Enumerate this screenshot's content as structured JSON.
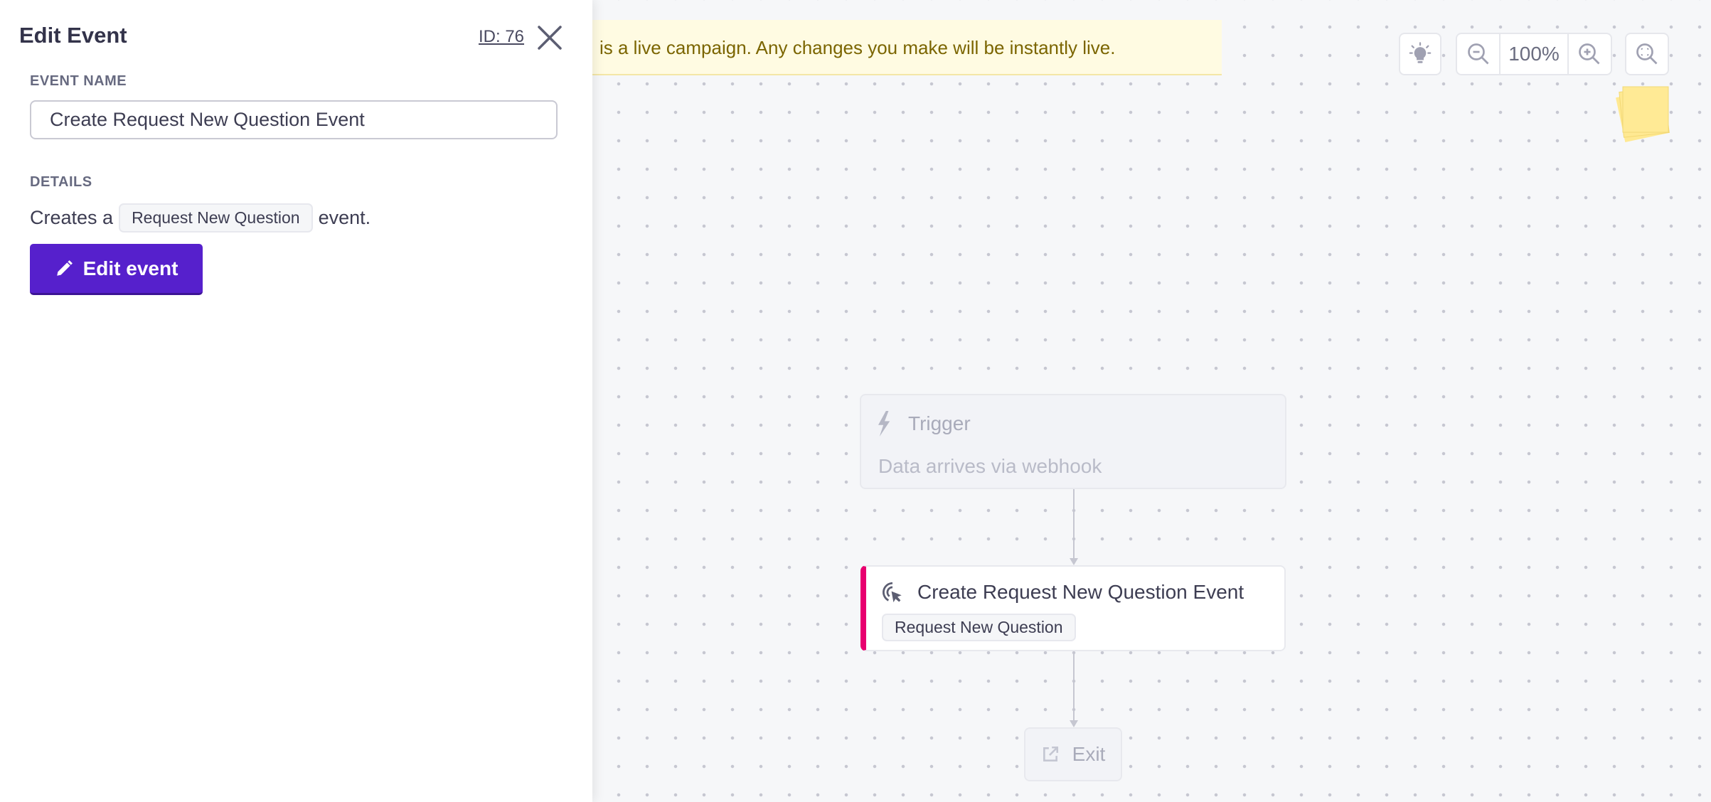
{
  "panel": {
    "title": "Edit Event",
    "id_label": "ID: 76",
    "event_name_label": "EVENT NAME",
    "event_name_value": "Create Request New Question Event",
    "details_label": "DETAILS",
    "details_prefix": "Creates a",
    "details_tag": "Request New Question",
    "details_suffix": "event.",
    "edit_button": "Edit event"
  },
  "banner": {
    "text": "is a live campaign. Any changes you make will be instantly live."
  },
  "toolbar": {
    "zoom_level": "100%",
    "icons": [
      "lightbulb-icon",
      "zoom-out-icon",
      "zoom-in-icon",
      "zoom-fit-icon"
    ]
  },
  "flow": {
    "trigger": {
      "title": "Trigger",
      "subtitle": "Data arrives via webhook"
    },
    "event": {
      "title": "Create Request New Question Event",
      "tag": "Request New Question",
      "accent": "#e8006f"
    },
    "exit": {
      "label": "Exit"
    }
  },
  "colors": {
    "primary": "#5620cc",
    "banner_bg": "#fffbe2",
    "sticky": "#ffe992"
  }
}
